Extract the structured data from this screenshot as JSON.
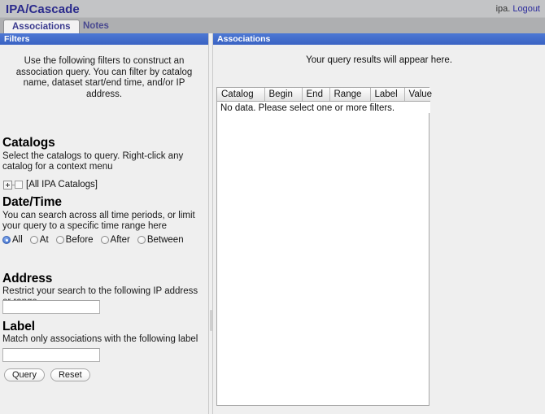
{
  "header": {
    "app_title": "IPA/Cascade",
    "user_name": "ipa.",
    "logout_label": "Logout"
  },
  "tabs": [
    {
      "label": "Associations",
      "active": true
    },
    {
      "label": "Notes",
      "active": false
    }
  ],
  "filters_panel": {
    "title": "Filters",
    "intro": "Use the following filters to construct an association query. You can filter by catalog name, dataset start/end time, and/or IP address.",
    "catalogs": {
      "heading": "Catalogs",
      "description": "Select the catalogs to query. Right-click any catalog for a context menu",
      "tree_root_label": "[All IPA Catalogs]",
      "expander_glyph": "+"
    },
    "datetime": {
      "heading": "Date/Time",
      "description": "You can search across all time periods, or limit your query to a specific time range here",
      "options": [
        {
          "label": "All",
          "checked": true
        },
        {
          "label": "At",
          "checked": false
        },
        {
          "label": "Before",
          "checked": false
        },
        {
          "label": "After",
          "checked": false
        },
        {
          "label": "Between",
          "checked": false
        }
      ]
    },
    "address": {
      "heading": "Address",
      "description": "Restrict your search to the following IP address or range",
      "value": "",
      "placeholder": ""
    },
    "label": {
      "heading": "Label",
      "description": "Match only associations with the following label",
      "value": "",
      "placeholder": ""
    },
    "buttons": {
      "query": "Query",
      "reset": "Reset"
    }
  },
  "associations_panel": {
    "title": "Associations",
    "hint": "Your query results will appear here.",
    "table": {
      "columns": [
        "Catalog",
        "Begin",
        "End",
        "Range",
        "Label",
        "Value"
      ],
      "rows": [],
      "empty_message": "No data. Please select one or more filters."
    }
  },
  "colors": {
    "accent_blue": "#3f6bcc",
    "title_blue": "#2a2a8c",
    "window_gray": "#c3c4c6",
    "panel_gray": "#efefef",
    "tab_strip_gray": "#aeafb1"
  }
}
